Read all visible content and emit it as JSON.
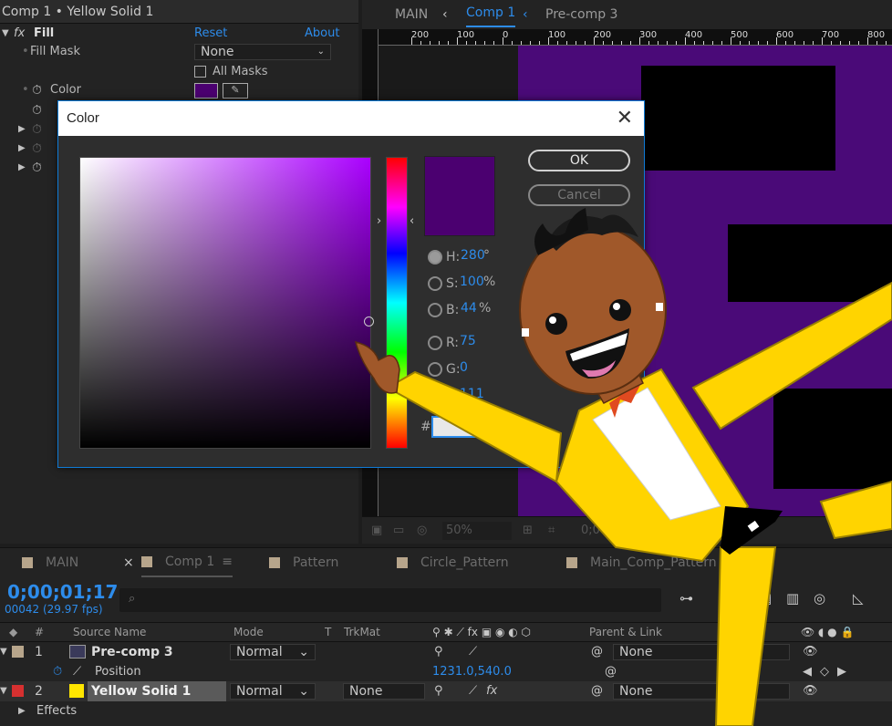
{
  "effects_panel": {
    "title": "Comp 1 • Yellow Solid 1",
    "fill_label": "Fill",
    "reset": "Reset",
    "about": "About",
    "fill_mask_label": "Fill Mask",
    "fill_mask_value": "None",
    "all_masks": "All Masks",
    "color_label": "Color",
    "color_value": "#4b0070"
  },
  "viewer": {
    "tabs": [
      "MAIN",
      "Comp 1",
      "Pre-comp 3"
    ],
    "ruler_labels": [
      "200",
      "100",
      "0",
      "100",
      "200",
      "300",
      "400",
      "500",
      "600",
      "700",
      "800"
    ],
    "zoom": "50%",
    "timecode": "0;00;01;17",
    "comp_bg": "#4a0a78"
  },
  "color_dialog": {
    "title": "Color",
    "close": "✕",
    "ok": "OK",
    "cancel": "Cancel",
    "h_label": "H:",
    "h_value": "280",
    "h_unit": "°",
    "s_label": "S:",
    "s_value": "100",
    "s_unit": "%",
    "b_label": "B:",
    "b_value": "44",
    "b_unit": "%",
    "r_label": "R:",
    "r_value": "75",
    "g_label": "G:",
    "g_value": "0",
    "bl_label": "B:",
    "bl_value": "111",
    "hex_label": "#",
    "selected_color": "#4b0070"
  },
  "timeline": {
    "tabs": [
      "MAIN",
      "Comp 1",
      "Pattern",
      "Circle_Pattern",
      "Main_Comp_Pattern"
    ],
    "timecode": "0;00;01;17",
    "frames": "00042 (29.97 fps)",
    "columns": {
      "num": "#",
      "source": "Source Name",
      "mode": "Mode",
      "t": "T",
      "trkmat": "TrkMat",
      "parent": "Parent & Link"
    },
    "layers": [
      {
        "num": "1",
        "name": "Pre-comp 3",
        "mode": "Normal",
        "parent": "None",
        "label_color": "#b7a58b"
      },
      {
        "num": "2",
        "name": "Yellow Solid 1",
        "mode": "Normal",
        "trkmat": "None",
        "parent": "None",
        "label_color": "#d63030"
      }
    ],
    "position_label": "Position",
    "position_value": "1231.0,540.0",
    "effects_label": "Effects"
  }
}
